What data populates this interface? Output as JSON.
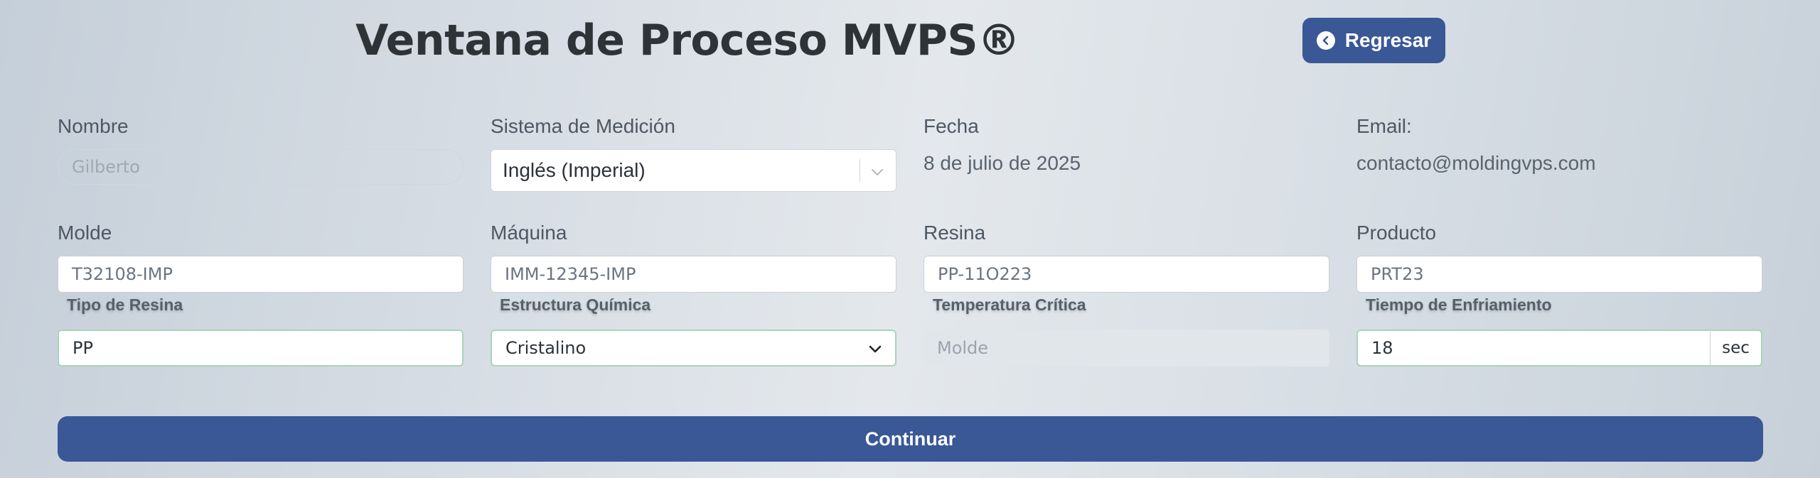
{
  "header": {
    "title": "Ventana de Proceso MVPS®",
    "back_label": "Regresar"
  },
  "row1": {
    "nombre_label": "Nombre",
    "nombre_placeholder": "Gilberto",
    "sistema_label": "Sistema de Medición",
    "sistema_value": "Inglés (Imperial)",
    "fecha_label": "Fecha",
    "fecha_value": "8 de julio de 2025",
    "email_label": "Email:",
    "email_value": "contacto@moldingvps.com"
  },
  "row2": {
    "molde_label": "Molde",
    "molde_value": "T32108-IMP",
    "maquina_label": "Máquina",
    "maquina_value": "IMM-12345-IMP",
    "resina_label": "Resina",
    "resina_value": "PP-11O223",
    "producto_label": "Producto",
    "producto_value": "PRT23"
  },
  "row3": {
    "tipo_resina_label": "Tipo de Resina",
    "tipo_resina_value": "PP",
    "estructura_label": "Estructura Química",
    "estructura_value": "Cristalino",
    "temp_label": "Temperatura Crítica",
    "temp_placeholder": "Molde",
    "enfriamiento_label": "Tiempo de Enfriamiento",
    "enfriamiento_value": "18",
    "enfriamiento_unit": "sec"
  },
  "actions": {
    "continue_label": "Continuar"
  },
  "colors": {
    "primary": "#3a5796",
    "field_border_valid": "#a8d4b8"
  }
}
